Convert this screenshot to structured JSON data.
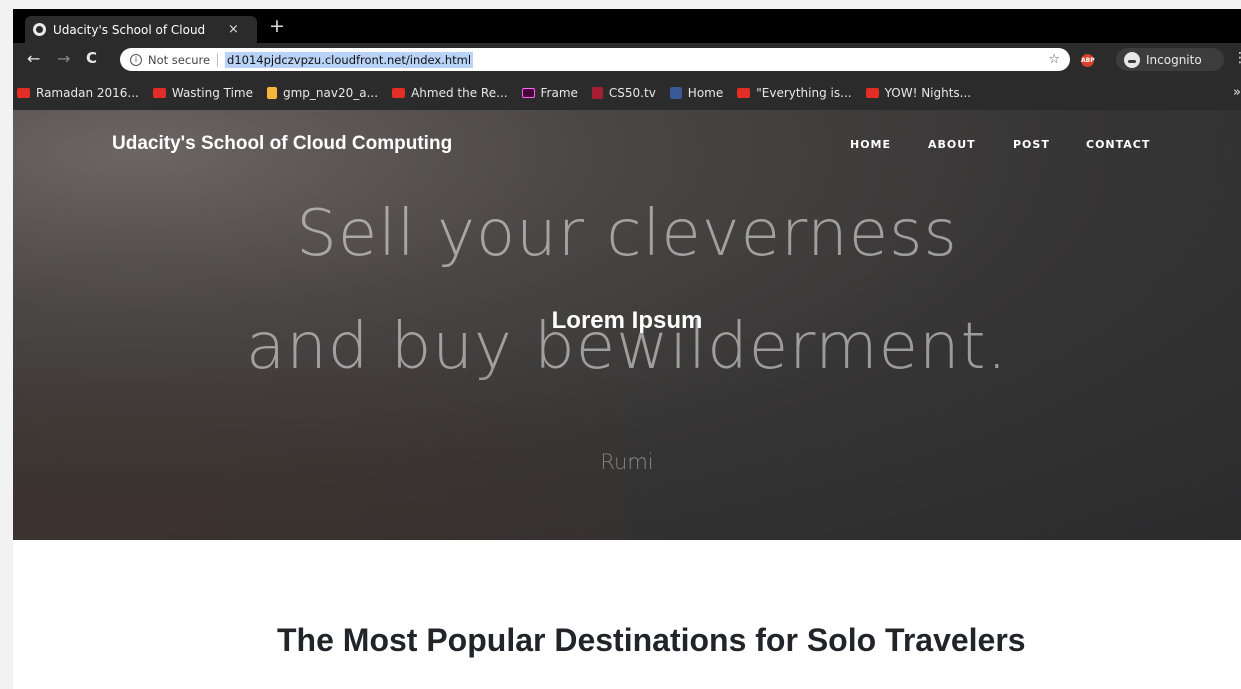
{
  "browser": {
    "tab_title": "Udacity's School of Cloud",
    "tab_close": "×",
    "new_tab": "+",
    "security_label": "Not secure",
    "url": "d1014pjdczvpzu.cloudfront.net/index.html",
    "incognito_label": "Incognito",
    "bookmarks": [
      {
        "label": "Ramadan 2016...",
        "icon": "youtube-icon"
      },
      {
        "label": "Wasting Time",
        "icon": "youtube-icon"
      },
      {
        "label": "gmp_nav20_a...",
        "icon": "folder-icon"
      },
      {
        "label": "Ahmed the Re...",
        "icon": "youtube-icon"
      },
      {
        "label": "Frame",
        "icon": "adobe-xd-icon"
      },
      {
        "label": "CS50.tv",
        "icon": "harvard-icon"
      },
      {
        "label": "Home",
        "icon": "facebook-icon"
      },
      {
        "label": "\"Everything is...",
        "icon": "youtube-icon"
      },
      {
        "label": "YOW! Nights...",
        "icon": "youtube-icon"
      }
    ],
    "more_bookmarks": "»"
  },
  "site": {
    "brand": "Udacity's School of Cloud Computing",
    "nav": [
      "HOME",
      "ABOUT",
      "POST",
      "CONTACT"
    ],
    "hero": {
      "quote_line1": "Sell your cleverness",
      "quote_line2": "and buy bewilderment.",
      "quote_author": "Rumi",
      "title": "Lorem Ipsum"
    },
    "article_title": "The Most Popular Destinations for Solo Travelers"
  },
  "colors": {
    "browser_chrome": "#2b2b2b",
    "url_highlight": "#b8d3f7",
    "hero_text": "#ffffff",
    "heading_text": "#212529"
  }
}
